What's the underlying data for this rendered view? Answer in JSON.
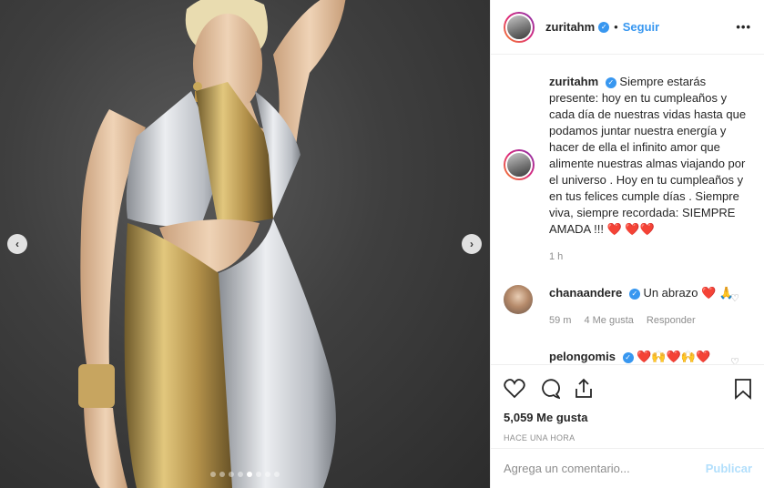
{
  "post": {
    "username": "zuritahm",
    "follow_label": "Seguir",
    "separator": "•",
    "more_label": "•••",
    "verified_glyph": "✓"
  },
  "caption": {
    "username": "zuritahm",
    "text": "Siempre estarás presente: hoy en tu cumpleaños y cada día de nuestras vidas hasta que podamos juntar nuestra energía y hacer de ella el infinito amor que alimente nuestras almas viajando por el universo . Hoy en tu cumpleaños y en tus felices cumple días . Siempre viva, siempre recordada: SIEMPRE AMADA !!! ",
    "hearts": "❤️ ❤️❤️",
    "time": "1 h"
  },
  "comments": [
    {
      "username": "chanaandere",
      "text": "Un abrazo ",
      "emoji": "❤️ 🙏",
      "time": "59 m",
      "likes": "4 Me gusta",
      "reply": "Responder"
    },
    {
      "username": "pelongomis",
      "text": "",
      "emoji": "❤️🙌❤️🙌❤️"
    }
  ],
  "actions": {
    "likes": "5,059 Me gusta",
    "timestamp": "Hace una hora"
  },
  "add_comment": {
    "placeholder": "Agrega un comentario...",
    "publish_label": "Publicar"
  },
  "carousel": {
    "prev_label": "‹",
    "next_label": "›",
    "dots": 8,
    "active_dot": 4
  },
  "colors": {
    "accent": "#3897f0",
    "heart": "#ed4956",
    "border": "#efefef",
    "muted": "#8e8e8e"
  },
  "icons": [
    "heart-icon",
    "comment-icon",
    "share-icon",
    "save-icon",
    "more-icon",
    "verified-icon"
  ]
}
